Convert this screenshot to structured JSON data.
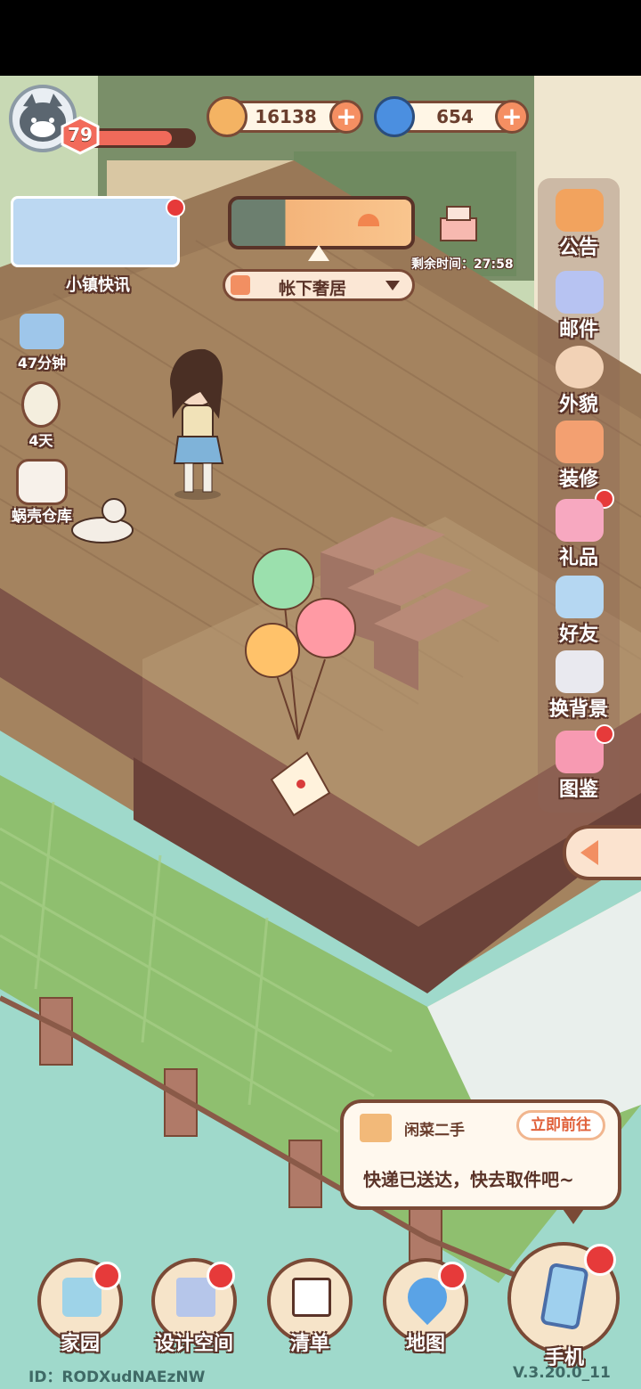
{
  "player": {
    "level": "79",
    "exp_fraction": 0.8
  },
  "currency": {
    "coins": "16138",
    "shells": "654"
  },
  "news": {
    "label": "小镇快讯"
  },
  "weather": {
    "countdown_label": "剩余时间：27:58"
  },
  "location": {
    "name": "帐下奢居"
  },
  "left_items": [
    {
      "label": "47分钟"
    },
    {
      "label": "4天"
    },
    {
      "label": "蜗壳仓库"
    }
  ],
  "side_menu": [
    {
      "label": "公告",
      "icon": "megaphone-icon",
      "badge": false
    },
    {
      "label": "邮件",
      "icon": "mail-icon",
      "badge": false
    },
    {
      "label": "外貌",
      "icon": "face-icon",
      "badge": false
    },
    {
      "label": "装修",
      "icon": "house-wrench-icon",
      "badge": true
    },
    {
      "label": "礼品",
      "icon": "gift-icon",
      "badge": false
    },
    {
      "label": "好友",
      "icon": "friends-icon",
      "badge": false
    },
    {
      "label": "换背景",
      "icon": "background-icon",
      "badge": false
    },
    {
      "label": "图鉴",
      "icon": "album-icon",
      "badge": true
    }
  ],
  "notification": {
    "title": "闲菜二手",
    "action": "立即前往",
    "message": "快递已送达，快去取件吧~"
  },
  "bottom_nav": [
    {
      "label": "家园",
      "icon": "home-icon"
    },
    {
      "label": "设计空间",
      "icon": "design-icon"
    },
    {
      "label": "清单",
      "icon": "checklist-icon"
    },
    {
      "label": "地图",
      "icon": "map-pin-icon"
    },
    {
      "label": "手机",
      "icon": "phone-icon"
    }
  ],
  "footer": {
    "id": "ID：RODXudNAEzNW",
    "version": "V.3.20.0_11"
  }
}
